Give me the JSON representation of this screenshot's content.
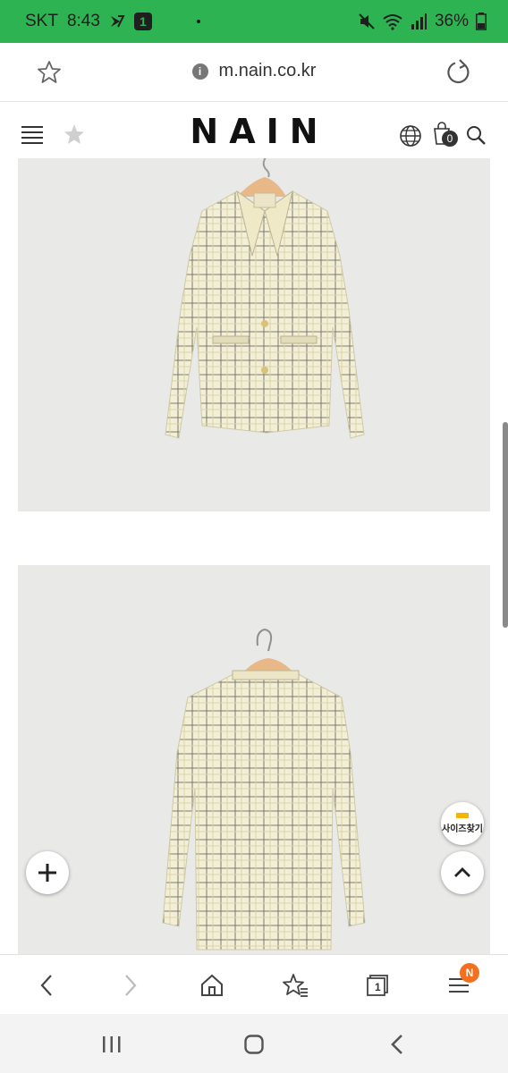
{
  "status_bar": {
    "carrier": "SKT",
    "time": "8:43",
    "notification_badge": "1",
    "battery": "36%",
    "background_color": "#2eb352"
  },
  "address_bar": {
    "url": "m.nain.co.kr"
  },
  "site_header": {
    "logo": "NAIN",
    "cart_count": "0"
  },
  "content": {
    "product_images": [
      {
        "subject": "front view of cream plaid tweed jacket on hanger"
      },
      {
        "subject": "back view of cream plaid tweed jacket on hanger"
      }
    ]
  },
  "floating": {
    "size_finder_label": "사이즈찾기"
  },
  "browser_toolbar": {
    "menu_badge": "N",
    "tab_count": "1",
    "badge_color": "#f37021"
  },
  "icons": [
    "star-icon",
    "info-icon",
    "reload-icon",
    "hamburger-menu-icon",
    "globe-icon",
    "cart-icon",
    "search-icon",
    "plus-icon",
    "chevron-up-icon",
    "back-icon",
    "forward-icon",
    "home-icon",
    "bookmarks-icon",
    "tabs-icon",
    "browser-menu-icon",
    "recents-icon",
    "home-nav-icon",
    "back-nav-icon"
  ]
}
